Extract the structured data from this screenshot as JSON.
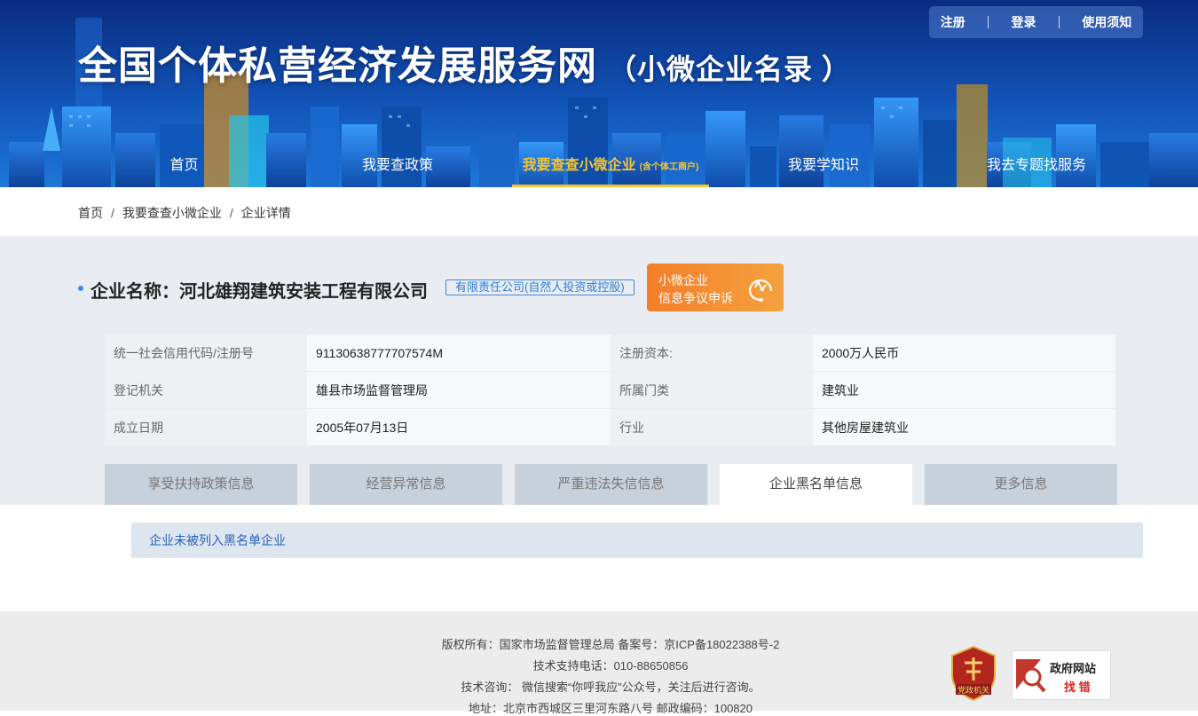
{
  "header": {
    "site_title": "全国个体私营经济发展服务网",
    "site_subtitle": "（小微企业名录 ）",
    "top_links": [
      "注册",
      "登录",
      "使用须知"
    ]
  },
  "nav": {
    "items": [
      {
        "label": "首页"
      },
      {
        "label": "我要查政策"
      },
      {
        "label": "我要查查小微企业",
        "note": "(含个体工商户)",
        "active": true
      },
      {
        "label": "我要学知识"
      },
      {
        "label": "我去专题找服务"
      }
    ]
  },
  "breadcrumb": [
    "首页",
    "我要查查小微企业",
    "企业详情"
  ],
  "company": {
    "name": "企业名称：河北雄翔建筑安装工程有限公司",
    "type_badge": "有限责任公司(自然人投资或控股)",
    "complaint_line1": "小微企业",
    "complaint_line2": "信息争议申诉"
  },
  "info_table": [
    {
      "k1": "统一社会信用代码/注册号",
      "v1": "91130638777707574M",
      "k2": "注册资本:",
      "v2": "2000万人民币"
    },
    {
      "k1": "登记机关",
      "v1": "雄县市场监督管理局",
      "k2": "所属门类",
      "v2": "建筑业"
    },
    {
      "k1": "成立日期",
      "v1": "2005年07月13日",
      "k2": "行业",
      "v2": "其他房屋建筑业"
    }
  ],
  "tabs": [
    {
      "label": "享受扶持政策信息"
    },
    {
      "label": "经营异常信息"
    },
    {
      "label": "严重违法失信信息"
    },
    {
      "label": "企业黑名单信息",
      "active": true
    },
    {
      "label": "更多信息"
    }
  ],
  "notice": "企业未被列入黑名单企业",
  "footer": {
    "lines": [
      "版权所有：国家市场监督管理总局 备案号：京ICP备18022388号-2",
      "技术支持电话：010-88650856",
      "技术咨询： 微信搜索“你呼我应”公众号，关注后进行咨询。",
      "地址：北京市西城区三里河东路八号 邮政编码：100820"
    ],
    "badge1_text": "党政机关",
    "badge2_line1": "政府网站",
    "badge2_line2": "找 错"
  },
  "colors": {
    "banner_blue": "#0d4bb1",
    "nav_active": "#f6c631",
    "accent_blue": "#2f7ed8",
    "complaint_orange": "#f37e2a",
    "badge_red": "#c0392b"
  }
}
